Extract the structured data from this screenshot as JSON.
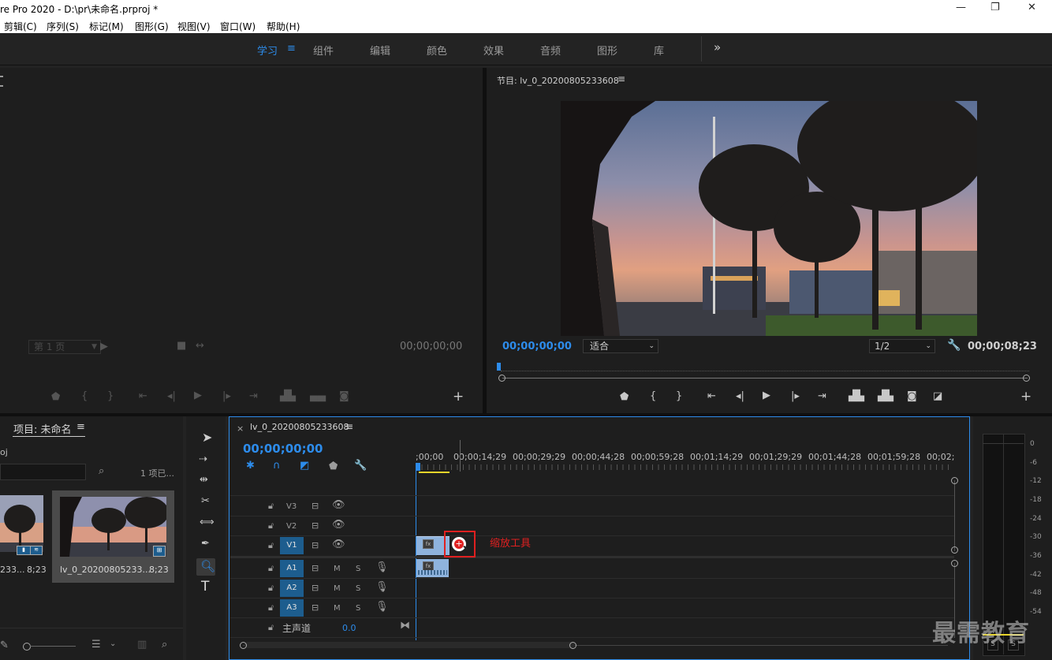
{
  "window": {
    "title": "re Pro 2020 - D:\\pr\\未命名.prproj *",
    "controls": [
      "—",
      "❐",
      "✕"
    ]
  },
  "menu": [
    "剪辑(C)",
    "序列(S)",
    "标记(M)",
    "图形(G)",
    "视图(V)",
    "窗口(W)",
    "帮助(H)"
  ],
  "workspaces": {
    "items": [
      "学习",
      "组件",
      "编辑",
      "颜色",
      "效果",
      "音频",
      "图形",
      "库"
    ],
    "active": "学习",
    "menu_icon": "≡",
    "overflow": "»"
  },
  "source_monitor": {
    "page_select": "第 1 页",
    "timecode": "00;00;00;00"
  },
  "program_monitor": {
    "title": "节目: lv_0_20200805233608",
    "menu_icon": "≡",
    "timecode_left": "00;00;00;00",
    "fit": "适合",
    "resolution": "1/2",
    "timecode_right": "00;00;08;23"
  },
  "project": {
    "title": "项目: 未命名",
    "menu_icon": "≡",
    "path_fragment": "oj",
    "items_count": "1 项已...",
    "items": [
      {
        "name": "233...",
        "duration": "8;23"
      },
      {
        "name": "lv_0_20200805233...",
        "duration": "8;23"
      }
    ]
  },
  "timeline": {
    "tab_title": "lv_0_20200805233608",
    "close": "×",
    "menu_icon": "≡",
    "timecode": "00;00;00;00",
    "ruler": [
      ";00;00",
      "00;00;14;29",
      "00;00;29;29",
      "00;00;44;28",
      "00;00;59;28",
      "00;01;14;29",
      "00;01;29;29",
      "00;01;44;28",
      "00;01;59;28",
      "00;02;"
    ],
    "video_tracks": [
      "V3",
      "V2",
      "V1"
    ],
    "audio_tracks": [
      "A1",
      "A2",
      "A3"
    ],
    "source_patch_v": "V1",
    "source_patch_a": "A1",
    "mute": "M",
    "solo": "S",
    "master_label": "主声道",
    "master_value": "0.0",
    "annotation": "缩放工具"
  },
  "audio_meter": {
    "scale": [
      "0",
      "-6",
      "-12",
      "-18",
      "-24",
      "-30",
      "-36",
      "-42",
      "-48",
      "-54"
    ],
    "solo_labels": [
      "S",
      "S"
    ]
  },
  "tools": [
    "selection-tool",
    "track-select-tool",
    "ripple-edit-tool",
    "razor-tool",
    "slip-tool",
    "pen-tool",
    "zoom-tool",
    "type-tool"
  ],
  "type_tool_glyph": "T",
  "watermark": "最需教育",
  "colors": {
    "accent": "#2d8ceb",
    "highlight_box": "#e02020",
    "clip": "#8fb3dd"
  }
}
